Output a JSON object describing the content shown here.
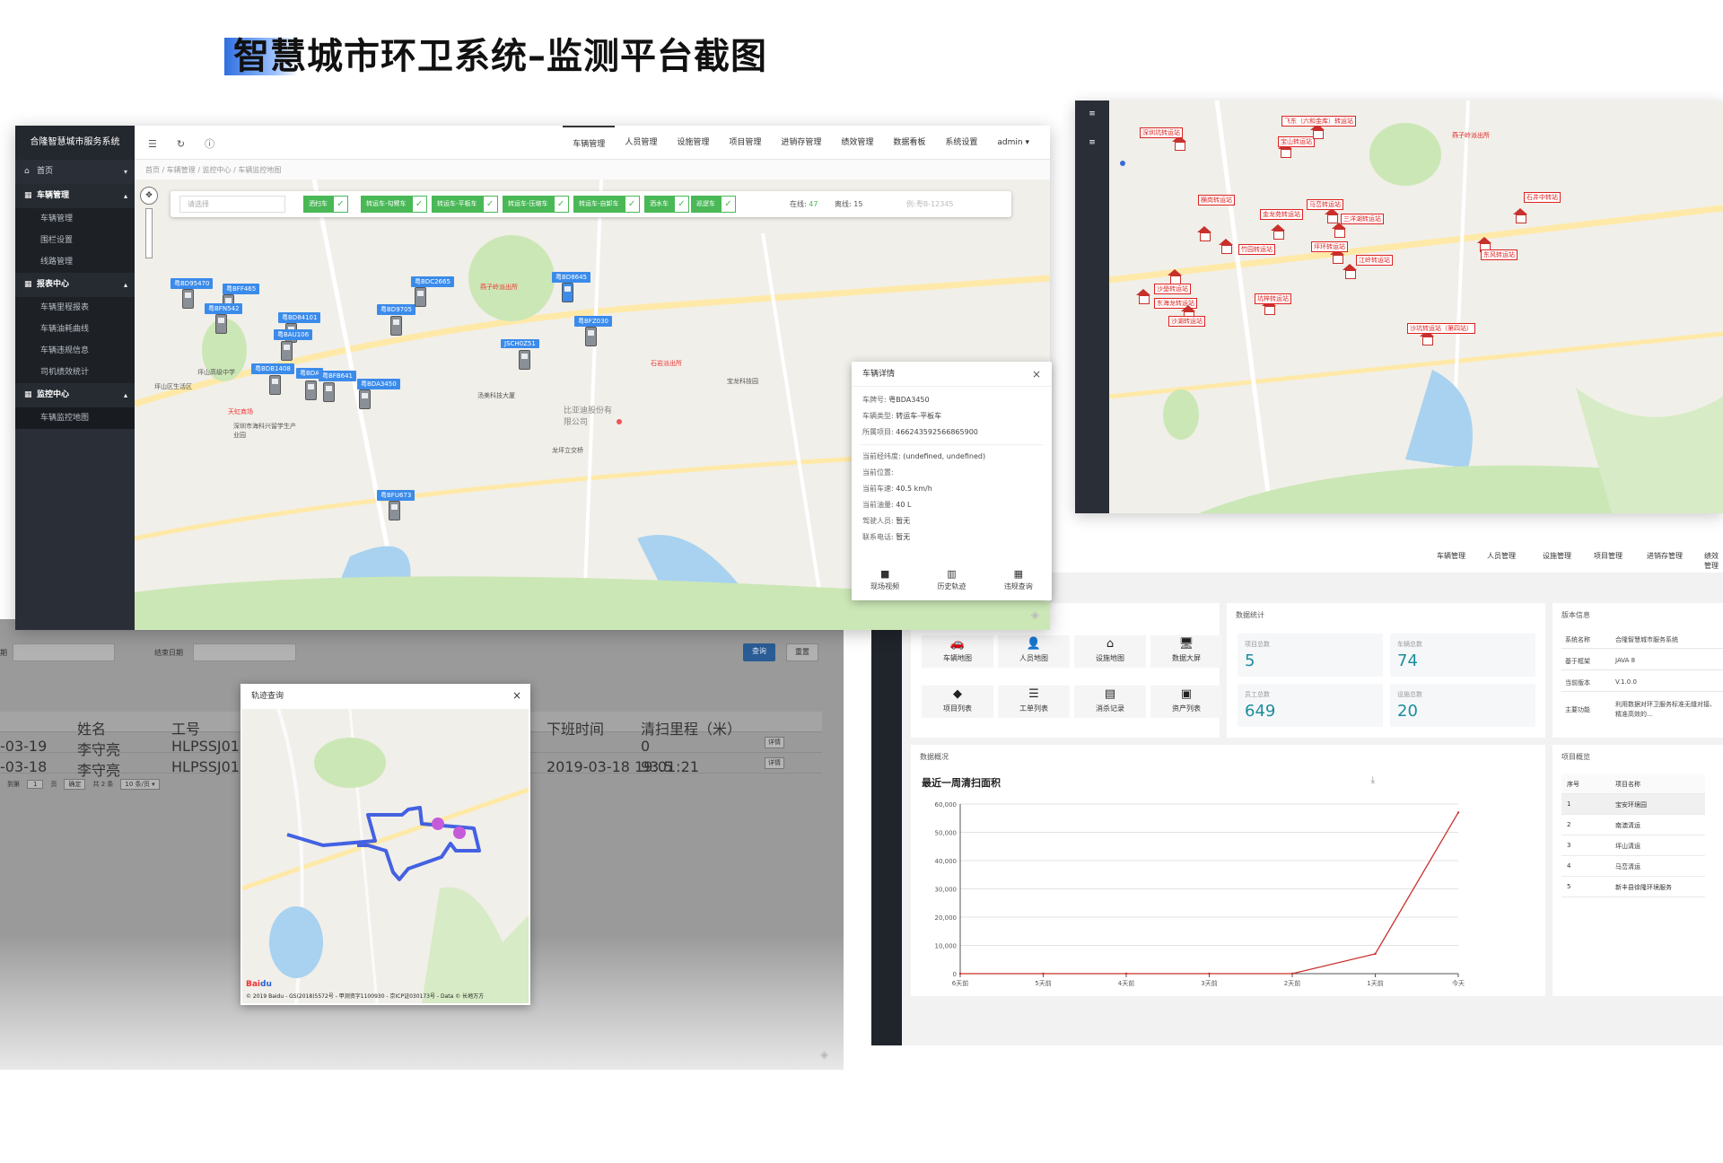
{
  "page_title": "智慧城市环卫系统–监测平台截图",
  "main": {
    "sidebar": {
      "title": "合隆智慧城市服务系统",
      "items": [
        {
          "label": "首页",
          "type": "item"
        },
        {
          "label": "车辆管理",
          "type": "group"
        },
        {
          "label": "车辆管理",
          "type": "sub"
        },
        {
          "label": "围栏设置",
          "type": "sub"
        },
        {
          "label": "线路管理",
          "type": "sub"
        },
        {
          "label": "报表中心",
          "type": "group"
        },
        {
          "label": "车辆里程报表",
          "type": "sub"
        },
        {
          "label": "车辆油耗曲线",
          "type": "sub"
        },
        {
          "label": "车辆违规信息",
          "type": "sub"
        },
        {
          "label": "司机绩效统计",
          "type": "sub"
        },
        {
          "label": "监控中心",
          "type": "group"
        },
        {
          "label": "车辆监控地图",
          "type": "sub"
        }
      ]
    },
    "topnav": [
      "车辆管理",
      "人员管理",
      "设施管理",
      "项目管理",
      "进销存管理",
      "绩效管理",
      "数据看板",
      "系统设置",
      "admin ▾"
    ],
    "breadcrumb": "首页 / 车辆管理 / 监控中心 / 车辆监控地图",
    "filter": {
      "select_placeholder": "请选择",
      "chips": [
        "洒扫车",
        "转运车-勾臂车",
        "转运车-平板车",
        "转运车-压缩车",
        "转运车-自卸车",
        "洒水车",
        "巡逻车"
      ],
      "online_label": "在线:",
      "online_value": "47",
      "offline_label": "离线:",
      "offline_value": "15",
      "search_placeholder": "例:粤B-12345"
    },
    "plates": [
      "粤BD95470",
      "粤BFF465",
      "粤BFN542",
      "粤BD84101",
      "粤BAU106",
      "粤BDB1408",
      "粤BDA",
      "粤BFB641",
      "粤BDA3450",
      "粤BD9705",
      "粤BDC2665",
      "粤BD8645",
      "粤BFZ030",
      "JSCH0Z51",
      "粤BFU673"
    ],
    "map_labels": [
      "石岩派出所",
      "燕子岭派出所",
      "深圳市海科兴留学生产业园",
      "坪山区生活区",
      "比亚迪股份有限公司",
      "汤美科技大厦",
      "宝龙科技园",
      "坪山高级中学",
      "天虹商场",
      "龙坪立交桥"
    ],
    "detail": {
      "title": "车辆详情",
      "rows": [
        {
          "k": "车牌号:",
          "v": "粤BDA3450"
        },
        {
          "k": "车辆类型:",
          "v": "转运车-平板车"
        },
        {
          "k": "所属项目:",
          "v": "466243592566865900"
        },
        {
          "k": "当前经纬度:",
          "v": "(undefined, undefined)"
        },
        {
          "k": "当前位置:",
          "v": ""
        },
        {
          "k": "当前车速:",
          "v": "40.5 km/h"
        },
        {
          "k": "当前油量:",
          "v": "40 L"
        },
        {
          "k": "驾驶人员:",
          "v": "暂无"
        },
        {
          "k": "联系电话:",
          "v": "暂无"
        }
      ],
      "actions": [
        "现场视频",
        "历史轨迹",
        "违规查询"
      ]
    }
  },
  "stations_map": {
    "stations": [
      "深圳坑转运站",
      "宝山转运站",
      "飞东（六和金库）转运站",
      "燕子岭派出所",
      "石井中转站",
      "横岗转运站",
      "马峦转运站",
      "三洋湖转运站",
      "金龙苑转运站",
      "竹园转运站",
      "坪环转运站",
      "江岭转运站",
      "沙壆转运站",
      "东风转运站",
      "坑梓转运站",
      "东海龙转运站",
      "沙湖转运站",
      "沙坑转运站（第四站）"
    ]
  },
  "history": {
    "start_label": "期",
    "end_label": "结束日期",
    "search_btn": "查询",
    "reset_btn": "重置",
    "columns": [
      "姓名",
      "工号",
      "下班时间",
      "清扫里程（米）"
    ],
    "rows": [
      {
        "date": "-03-19",
        "name": "李守亮",
        "id": "HLPSSJ011",
        "off": "",
        "dist": "0",
        "op": "详情"
      },
      {
        "date": "-03-18",
        "name": "李守亮",
        "id": "HLPSSJ011",
        "off": "2019-03-18 19:01:21",
        "dist": "93.5",
        "op": "详情"
      }
    ],
    "pager": {
      "goto": "到第",
      "page": "1",
      "unit": "页",
      "ok": "确定",
      "total": "共 2 条",
      "size": "10 条/页 ▾"
    },
    "track": {
      "title": "轨迹查询",
      "baidu": "Bai",
      "baidu_b": "du",
      "copyright": "© 2019 Baidu - GS(2018)5572号 - 甲测资字1100930 - 京ICP证030173号 - Data © 长地万方"
    }
  },
  "dashboard": {
    "topnav": [
      "车辆管理",
      "人员管理",
      "设施管理",
      "项目管理",
      "进销存管理",
      "绩效管理"
    ],
    "tiles": [
      {
        "icon": "🚗",
        "label": "车辆地图"
      },
      {
        "icon": "👤",
        "label": "人员地图"
      },
      {
        "icon": "⌂",
        "label": "设施地图"
      },
      {
        "icon": "🖥",
        "label": "数据大屏"
      },
      {
        "icon": "◆",
        "label": "项目列表"
      },
      {
        "icon": "☰",
        "label": "工单列表"
      },
      {
        "icon": "▤",
        "label": "消杀记录"
      },
      {
        "icon": "▣",
        "label": "资产列表"
      }
    ],
    "stats_title": "数据统计",
    "stats": [
      {
        "label": "项目总数",
        "value": "5"
      },
      {
        "label": "车辆总数",
        "value": "74"
      },
      {
        "label": "员工总数",
        "value": "649"
      },
      {
        "label": "设施总数",
        "value": "20"
      }
    ],
    "version": {
      "title": "版本信息",
      "rows": [
        {
          "k": "系统名称",
          "v": "合隆智慧城市服务系统"
        },
        {
          "k": "基于框架",
          "v": "JAVA 8"
        },
        {
          "k": "当前版本",
          "v": "V.1.0.0"
        },
        {
          "k": "主要功能",
          "v": "利用数据对环卫服务标准无缝对接、精准高效的…"
        }
      ]
    },
    "overview_title": "数据概况",
    "projects": {
      "title": "项目概览",
      "columns": [
        "序号",
        "项目名称"
      ],
      "rows": [
        {
          "no": "1",
          "name": "宝安环境园"
        },
        {
          "no": "2",
          "name": "南澳清运"
        },
        {
          "no": "3",
          "name": "坪山清运"
        },
        {
          "no": "4",
          "name": "马峦清运"
        },
        {
          "no": "5",
          "name": "新丰县徐隆环境服务"
        }
      ]
    }
  },
  "chart_data": {
    "type": "line",
    "title": "最近一周清扫面积",
    "categories": [
      "6天前",
      "5天前",
      "4天前",
      "3天前",
      "2天前",
      "1天前",
      "今天"
    ],
    "series": [
      {
        "values": [
          0,
          0,
          0,
          0,
          0,
          7000,
          57000
        ]
      }
    ],
    "ylim": [
      0,
      60000
    ],
    "yticks": [
      "0",
      "10,000",
      "20,000",
      "30,000",
      "40,000",
      "50,000",
      "60,000"
    ],
    "color": "#c9302c"
  }
}
